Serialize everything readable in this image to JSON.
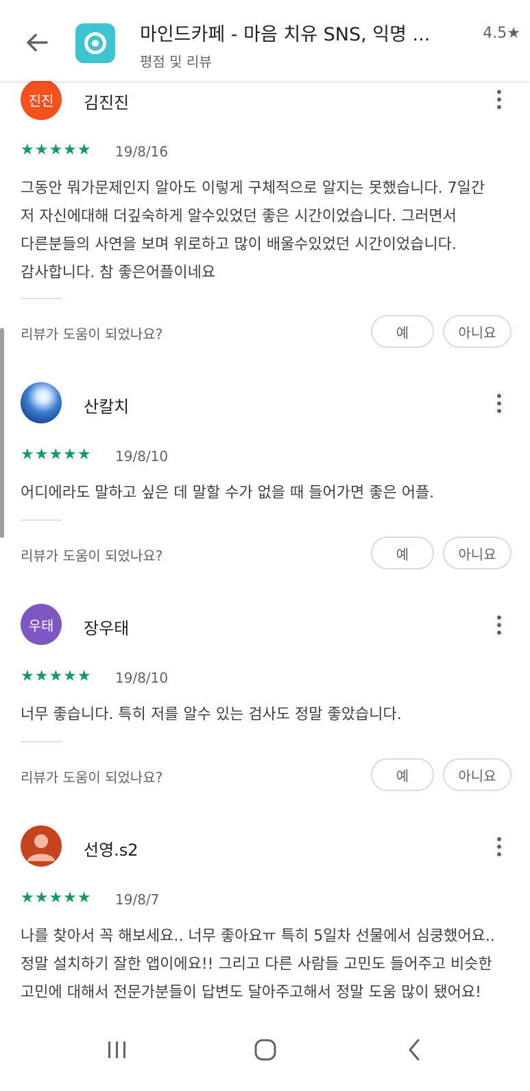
{
  "header": {
    "title": "마인드카페 - 마음 치유 SNS, 익명 ...",
    "subtitle": "평점 및 리뷰",
    "rating": "4.5★"
  },
  "icons": {
    "back": "arrow-back-icon",
    "app": "app-icon",
    "more": "more-vert-icon",
    "star": "star-icon"
  },
  "colors": {
    "star": "#0f9d58",
    "avatar_1": "#f4511e",
    "avatar_3": "#7e57c2",
    "avatar_4": "#e06e4a",
    "app_icon": "#3cc5cf"
  },
  "reviews": [
    {
      "avatar_text": "진진",
      "author": "김진진",
      "stars": "★★★★★",
      "rating": 5,
      "date": "19/8/16",
      "lines": [
        "그동안 뭐가문제인지 알아도 이렇게 구체적으로 알지는 못했습니다. 7일간",
        "저 자신에대해 더깊숙하게 알수있었던 좋은 시간이었습니다. 그러면서",
        "다른분들의 사연을 보며 위로하고 많이 배울수있었던 시간이었습니다.",
        "감사합니다. 참 좋은어플이네요"
      ],
      "helpful_q": "리뷰가 도움이 되었나요?",
      "yes": "예",
      "no": "아니요"
    },
    {
      "avatar_text": "",
      "author": "산칼치",
      "stars": "★★★★★",
      "rating": 5,
      "date": "19/8/10",
      "lines": [
        "어디에라도 말하고 싶은 데 말할 수가 없을 때 들어가면 좋은 어플."
      ],
      "helpful_q": "리뷰가 도움이 되었나요?",
      "yes": "예",
      "no": "아니요"
    },
    {
      "avatar_text": "우태",
      "author": "장우태",
      "stars": "★★★★★",
      "rating": 5,
      "date": "19/8/10",
      "lines": [
        "너무 좋습니다. 특히 저를 알수 있는 검사도 정말 좋았습니다."
      ],
      "helpful_q": "리뷰가 도움이 되었나요?",
      "yes": "예",
      "no": "아니요"
    },
    {
      "avatar_text": "",
      "author": "선영.s2",
      "stars": "★★★★★",
      "rating": 5,
      "date": "19/8/7",
      "lines": [
        "나를 찾아서 꼭 해보세요.. 너무 좋아요ㅠ 특히 5일차 선물에서 심쿵했어요..",
        "정말 설치하기 잘한 앱이에요!! 그리고 다른 사람들 고민도 들어주고 비슷한",
        "고민에 대해서 전문가분들이 답변도 달아주고해서 정말 도움 많이 됐어요!"
      ]
    }
  ],
  "navbar": {
    "recents": "recents-icon",
    "home": "home-icon",
    "back": "nav-back-icon"
  }
}
